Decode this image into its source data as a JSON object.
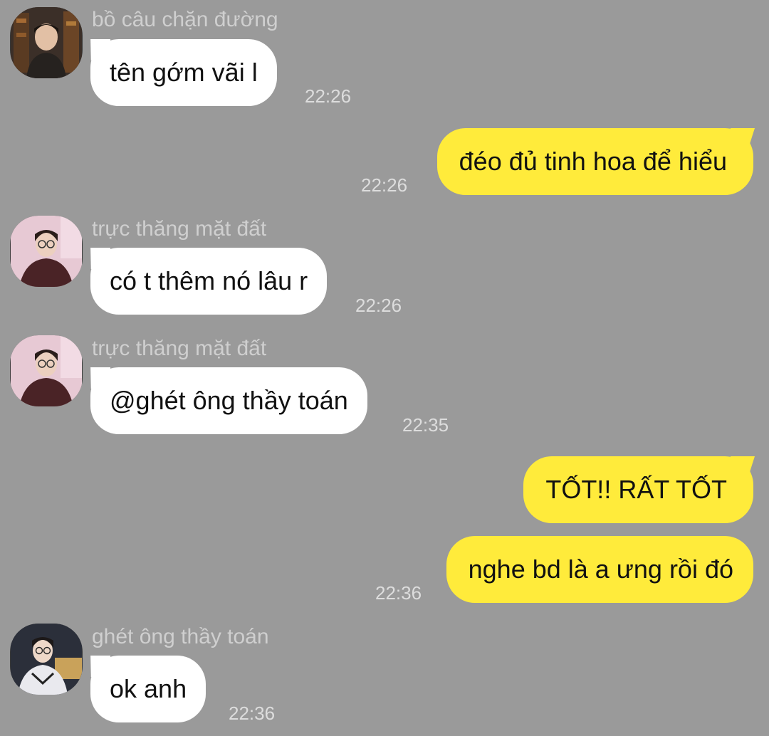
{
  "messages": [
    {
      "sender": "bồ câu chặn đường",
      "text": "tên gớm vãi l",
      "time": "22:26"
    },
    {
      "text": "đéo đủ tinh hoa để hiểu",
      "time": "22:26"
    },
    {
      "sender": "trực thăng mặt đất",
      "text": "có t thêm nó lâu r",
      "time": "22:26"
    },
    {
      "sender": "trực thăng mặt đất",
      "text": "@ghét ông thầy toán",
      "time": "22:35"
    },
    {
      "text": "TỐT!! RẤT TỐT"
    },
    {
      "text": "nghe bd là a ưng rồi đó",
      "time": "22:36"
    },
    {
      "sender": "ghét ông thầy toán",
      "text": "ok anh",
      "time": "22:36"
    }
  ],
  "colors": {
    "background": "#9a9a9a",
    "incoming_bubble": "#ffffff",
    "outgoing_bubble": "#ffeb3b",
    "meta_text": "#cfcfcf"
  }
}
